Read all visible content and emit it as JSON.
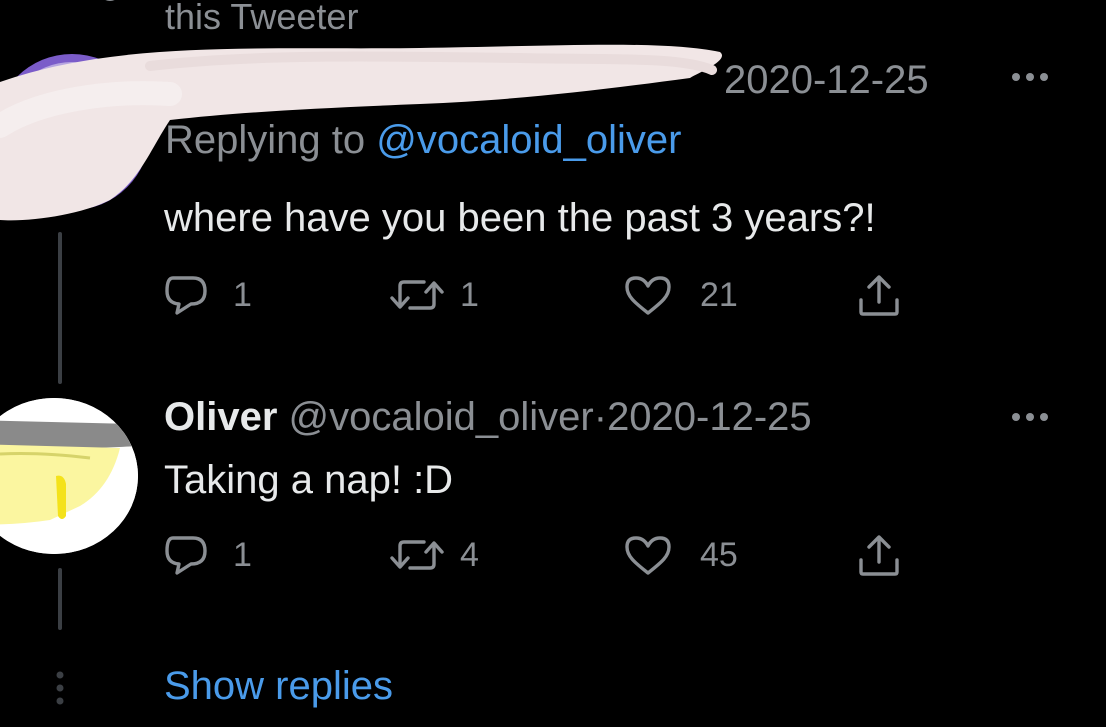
{
  "header": {
    "context_label": "this Tweeter",
    "heart_icon": "heart-icon"
  },
  "tweet1": {
    "date": "2020-12-25",
    "replying_prefix": "Replying to",
    "replying_to": "@vocaloid_oliver",
    "text": "where have you been the past 3 years?!",
    "replies": "1",
    "retweets": "1",
    "likes": "21",
    "more_icon": "more-icon",
    "redacted_avatar_color": "#7b5cc9"
  },
  "tweet2": {
    "display_name": "Oliver",
    "handle": "@vocaloid_oliver",
    "separator": "·",
    "date": "2020-12-25",
    "text": "Taking a nap! :D",
    "replies": "1",
    "retweets": "4",
    "likes": "45",
    "more_icon": "more-icon",
    "avatar_colors": [
      "#ffffff",
      "#8a8a8a",
      "#fbf6a0",
      "#f4e21a"
    ]
  },
  "footer": {
    "show_replies": "Show replies"
  },
  "colors": {
    "background": "#000000",
    "text_primary": "#e7e9ea",
    "text_secondary": "#8b8f94",
    "link": "#4a9bea",
    "redaction": "#f1e6e6"
  }
}
